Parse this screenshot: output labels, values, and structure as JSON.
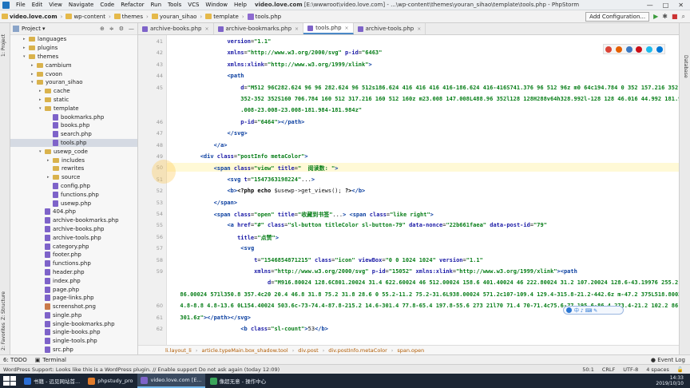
{
  "menubar": {
    "items": [
      "File",
      "Edit",
      "View",
      "Navigate",
      "Code",
      "Refactor",
      "Run",
      "Tools",
      "VCS",
      "Window",
      "Help"
    ],
    "title_project": "video.love.com",
    "title_rest": "[E:\\wwwroot\\video.love.com] - ...\\wp-content\\themes\\youran_sihao\\template\\tools.php - PhpStorm",
    "controls": [
      "—",
      "□",
      "✕"
    ]
  },
  "navbar": {
    "crumbs": [
      "video.love.com",
      "wp-content",
      "themes",
      "youran_sihao",
      "template",
      "tools.php"
    ],
    "config_button": "Add Configuration..."
  },
  "leftstrip": {
    "labels": [
      "1: Project",
      "Z: Structure",
      "2: Favorites"
    ]
  },
  "rightstrip": {
    "label": "Database"
  },
  "project": {
    "title": "Project",
    "tree": [
      {
        "label": "languages",
        "kind": "folder",
        "depth": 2,
        "arrow": "▸"
      },
      {
        "label": "plugins",
        "kind": "folder",
        "depth": 2,
        "arrow": "▸"
      },
      {
        "label": "themes",
        "kind": "folder",
        "depth": 2,
        "arrow": "▾"
      },
      {
        "label": "cambium",
        "kind": "folder",
        "depth": 3,
        "arrow": "▸"
      },
      {
        "label": "cvoon",
        "kind": "folder",
        "depth": 3,
        "arrow": "▸"
      },
      {
        "label": "youran_sihao",
        "kind": "folder",
        "depth": 3,
        "arrow": "▾"
      },
      {
        "label": "cache",
        "kind": "folder",
        "depth": 4,
        "arrow": "▸"
      },
      {
        "label": "static",
        "kind": "folder",
        "depth": 4,
        "arrow": "▸"
      },
      {
        "label": "template",
        "kind": "folder",
        "depth": 4,
        "arrow": "▾"
      },
      {
        "label": "bookmarks.php",
        "kind": "php",
        "depth": 5,
        "arrow": ""
      },
      {
        "label": "books.php",
        "kind": "php",
        "depth": 5,
        "arrow": ""
      },
      {
        "label": "search.php",
        "kind": "php",
        "depth": 5,
        "arrow": ""
      },
      {
        "label": "tools.php",
        "kind": "php",
        "depth": 5,
        "arrow": "",
        "selected": true
      },
      {
        "label": "usewp_code",
        "kind": "folder",
        "depth": 4,
        "arrow": "▾"
      },
      {
        "label": "includes",
        "kind": "folder",
        "depth": 5,
        "arrow": "▸"
      },
      {
        "label": "rewrites",
        "kind": "folder",
        "depth": 5,
        "arrow": ""
      },
      {
        "label": "source",
        "kind": "folder",
        "depth": 5,
        "arrow": "▸"
      },
      {
        "label": "config.php",
        "kind": "php",
        "depth": 5,
        "arrow": ""
      },
      {
        "label": "functions.php",
        "kind": "php",
        "depth": 5,
        "arrow": ""
      },
      {
        "label": "usewp.php",
        "kind": "php",
        "depth": 5,
        "arrow": ""
      },
      {
        "label": "404.php",
        "kind": "php",
        "depth": 4,
        "arrow": ""
      },
      {
        "label": "archive-bookmarks.php",
        "kind": "php",
        "depth": 4,
        "arrow": ""
      },
      {
        "label": "archive-books.php",
        "kind": "php",
        "depth": 4,
        "arrow": ""
      },
      {
        "label": "archive-tools.php",
        "kind": "php",
        "depth": 4,
        "arrow": ""
      },
      {
        "label": "category.php",
        "kind": "php",
        "depth": 4,
        "arrow": ""
      },
      {
        "label": "footer.php",
        "kind": "php",
        "depth": 4,
        "arrow": ""
      },
      {
        "label": "functions.php",
        "kind": "php",
        "depth": 4,
        "arrow": ""
      },
      {
        "label": "header.php",
        "kind": "php",
        "depth": 4,
        "arrow": ""
      },
      {
        "label": "index.php",
        "kind": "php",
        "depth": 4,
        "arrow": ""
      },
      {
        "label": "page.php",
        "kind": "php",
        "depth": 4,
        "arrow": ""
      },
      {
        "label": "page-links.php",
        "kind": "php",
        "depth": 4,
        "arrow": ""
      },
      {
        "label": "screenshot.png",
        "kind": "img",
        "depth": 4,
        "arrow": ""
      },
      {
        "label": "single.php",
        "kind": "php",
        "depth": 4,
        "arrow": ""
      },
      {
        "label": "single-bookmarks.php",
        "kind": "php",
        "depth": 4,
        "arrow": ""
      },
      {
        "label": "single-books.php",
        "kind": "php",
        "depth": 4,
        "arrow": ""
      },
      {
        "label": "single-tools.php",
        "kind": "php",
        "depth": 4,
        "arrow": ""
      },
      {
        "label": "src.php",
        "kind": "php",
        "depth": 4,
        "arrow": ""
      }
    ]
  },
  "tabs": [
    {
      "label": "archive-books.php",
      "active": false
    },
    {
      "label": "archive-bookmarks.php",
      "active": false
    },
    {
      "label": "tools.php",
      "active": true
    },
    {
      "label": "archive-tools.php",
      "active": false
    }
  ],
  "line_numbers": [
    "41",
    "42",
    "43",
    "44",
    "45",
    "",
    "",
    "46",
    "47",
    "48",
    "49",
    "50",
    "51",
    "52",
    "53",
    "54",
    "55",
    "56",
    "57",
    "58",
    "59",
    "",
    "",
    "60",
    "61",
    "62"
  ],
  "code_lines": [
    [
      [
        "",
        "                "
      ],
      [
        "at",
        "version"
      ],
      [
        "",
        "="
      ],
      [
        "sv",
        "\"1.1\""
      ]
    ],
    [
      [
        "",
        "                "
      ],
      [
        "at",
        "xmlns"
      ],
      [
        "",
        "="
      ],
      [
        "sv",
        "\"http://www.w3.org/2000/svg\""
      ],
      [
        "",
        " "
      ],
      [
        "at",
        "p-id"
      ],
      [
        "",
        "="
      ],
      [
        "sv",
        "\"6463\""
      ]
    ],
    [
      [
        "",
        "                "
      ],
      [
        "at",
        "xmlns:xlink"
      ],
      [
        "",
        "="
      ],
      [
        "sv",
        "\"http://www.w3.org/1999/xlink\""
      ],
      [
        "tg",
        ">"
      ]
    ],
    [
      [
        "",
        "                "
      ],
      [
        "tg",
        "<path"
      ]
    ],
    [
      [
        "",
        "                    "
      ],
      [
        "at",
        "d"
      ],
      [
        "",
        "="
      ],
      [
        "sv",
        "\"M512 96C282.624 96 96 282.624 96 512s186.624 416 416 416 416-186.624 416-416S741.376 96 512 96z m0 64c194.784 0 352 157.216 352 352s-157.216"
      ]
    ],
    [
      [
        "sv",
        "                    352-352 352S160 706.784 160 512 317.216 160 512 160z m23.008 147.008L488.96 352l128 128H288v64h328.992l-128 128 46.016 44.992 181.984-181.984 23.008-23"
      ]
    ],
    [
      [
        "sv",
        "                    .008-23.008-23.008-181.984-181.984z\""
      ]
    ],
    [
      [
        "",
        "                    "
      ],
      [
        "at",
        "p-id"
      ],
      [
        "",
        "="
      ],
      [
        "sv",
        "\"6464\""
      ],
      [
        "tg",
        "></path>"
      ]
    ],
    [
      [
        "",
        "                "
      ],
      [
        "tg",
        "</svg>"
      ]
    ],
    [
      [
        "",
        "            "
      ],
      [
        "tg",
        "</a>"
      ]
    ],
    [
      [
        "",
        "        "
      ],
      [
        "tg",
        "<div "
      ],
      [
        "at",
        "class"
      ],
      [
        "",
        "="
      ],
      [
        "sv",
        "\"postInfo metaColor\""
      ],
      [
        "tg",
        ">"
      ]
    ],
    [
      [
        "",
        "            "
      ],
      [
        "tg",
        "<span "
      ],
      [
        "at",
        "class"
      ],
      [
        "",
        "="
      ],
      [
        "sv",
        "\"view\""
      ],
      [
        "",
        " "
      ],
      [
        "at",
        "title"
      ],
      [
        "",
        "="
      ],
      [
        "sv",
        "\"  阅读数: \""
      ],
      [
        "tg",
        ">"
      ]
    ],
    [
      [
        "",
        "                "
      ],
      [
        "tg",
        "<svg "
      ],
      [
        "at",
        "t"
      ],
      [
        "",
        "="
      ],
      [
        "sv",
        "\"1547363198224\""
      ],
      [
        "",
        "..."
      ],
      [
        "tg",
        ">"
      ]
    ],
    [
      [
        "",
        "                "
      ],
      [
        "tg",
        "<b>"
      ],
      [
        "pc",
        "<?php echo "
      ],
      [
        "",
        "$usewp->get_views(); "
      ],
      [
        "pc",
        "?>"
      ],
      [
        "tg",
        "</b>"
      ]
    ],
    [
      [
        "",
        "            "
      ],
      [
        "tg",
        "</span>"
      ]
    ],
    [
      [
        "",
        "            "
      ],
      [
        "tg",
        "<span "
      ],
      [
        "at",
        "class"
      ],
      [
        "",
        "="
      ],
      [
        "sv",
        "\"open\""
      ],
      [
        "",
        " "
      ],
      [
        "at",
        "title"
      ],
      [
        "",
        "="
      ],
      [
        "sv",
        "\"收藏到书签\""
      ],
      [
        "",
        "..."
      ],
      [
        "tg",
        "> <span "
      ],
      [
        "at",
        "class"
      ],
      [
        "",
        "="
      ],
      [
        "sv",
        "\"like right\""
      ],
      [
        "tg",
        ">"
      ]
    ],
    [
      [
        "",
        "                "
      ],
      [
        "tg",
        "<a "
      ],
      [
        "at",
        "href"
      ],
      [
        "",
        "="
      ],
      [
        "sv",
        "\"#\""
      ],
      [
        "",
        " "
      ],
      [
        "at",
        "class"
      ],
      [
        "",
        "="
      ],
      [
        "sv",
        "\"sl-button titleColor sl-button-79\""
      ],
      [
        "",
        " "
      ],
      [
        "at",
        "data-nonce"
      ],
      [
        "",
        "="
      ],
      [
        "sv",
        "\"22b661faea\""
      ],
      [
        "",
        " "
      ],
      [
        "at",
        "data-post-id"
      ],
      [
        "",
        "="
      ],
      [
        "sv",
        "\"79\""
      ]
    ],
    [
      [
        "",
        "                   "
      ],
      [
        "at",
        "title"
      ],
      [
        "",
        "="
      ],
      [
        "sv",
        "\"点赞\""
      ],
      [
        "tg",
        ">"
      ]
    ],
    [
      [
        "",
        "                    "
      ],
      [
        "tg",
        "<svg"
      ]
    ],
    [
      [
        "",
        "                        "
      ],
      [
        "at",
        "t"
      ],
      [
        "",
        "="
      ],
      [
        "sv",
        "\"1546854871215\""
      ],
      [
        "",
        " "
      ],
      [
        "at",
        "class"
      ],
      [
        "",
        "="
      ],
      [
        "sv",
        "\"icon\""
      ],
      [
        "",
        " "
      ],
      [
        "at",
        "viewBox"
      ],
      [
        "",
        "="
      ],
      [
        "sv",
        "\"0 0 1024 1024\""
      ],
      [
        "",
        " "
      ],
      [
        "at",
        "version"
      ],
      [
        "",
        "="
      ],
      [
        "sv",
        "\"1.1\""
      ]
    ],
    [
      [
        "",
        "                        "
      ],
      [
        "at",
        "xmlns"
      ],
      [
        "",
        "="
      ],
      [
        "sv",
        "\"http://www.w3.org/2000/svg\""
      ],
      [
        "",
        " "
      ],
      [
        "at",
        "p-id"
      ],
      [
        "",
        "="
      ],
      [
        "sv",
        "\"15052\""
      ],
      [
        "",
        " "
      ],
      [
        "at",
        "xmlns:xlink"
      ],
      [
        "",
        "="
      ],
      [
        "sv",
        "\"http://www.w3.org/1999/xlink\""
      ],
      [
        "tg",
        "><path"
      ]
    ],
    [
      [
        "",
        "                            "
      ],
      [
        "at",
        "d"
      ],
      [
        "",
        "="
      ],
      [
        "sv",
        "\"M916.80024 128.6C801.20024 31.4 622.60024 46 512.00024 158.6 401.40024 46 222.80024 31.2 107.20024 128.6-43.19976 255.2-21.19976 461.6"
      ]
    ],
    [
      [
        "sv",
        "  86.00024 571l350.8 357.4c20 20.4 46.8 31.8 75.2 31.8 28.6 0 55.2-11.2 75.2-31.6L938.00024 571.2c107-109.4 129.4-315.8-21.2-442.6z m-47.2 375L518.80024 861c-4.8"
      ]
    ],
    [
      [
        "sv",
        "  4.8-8.8 4.8-13.6 0L154.40024 503.6c-73-74.4-87.8-215.2 14.6-301.4 77.8-65.4 197.8-55.6 273 21l70 71.4 70-71.4c75.6-77 195.6-86.4 273.4-21.2 102.2 86.4 87.2 227.8 14.6"
      ]
    ],
    [
      [
        "sv",
        "  301.6z\""
      ],
      [
        "tg",
        "></path></svg>"
      ]
    ],
    [
      [
        "",
        "                    "
      ],
      [
        "tg",
        "<b "
      ],
      [
        "at",
        "class"
      ],
      [
        "",
        "="
      ],
      [
        "sv",
        "\"sl-count\""
      ],
      [
        "tg",
        ">"
      ],
      [
        "",
        "53"
      ],
      [
        "tg",
        "</b>"
      ]
    ]
  ],
  "breadcrumb": [
    "li.layout_li",
    "article.typeMain.box_shadow.tool",
    "div.post",
    "div.postInfo.metaColor",
    "span.open"
  ],
  "toolbar": {
    "todo": "6: TODO",
    "terminal": "Terminal",
    "event_log": "Event Log"
  },
  "status": {
    "message": "WordPress Support: Looks like this is a WordPress plugin. // Enable support   Do not ask again (today 12:09)",
    "position": "50:1",
    "line_sep": "CRLF",
    "encoding": "UTF-8",
    "indent": "4 spaces"
  },
  "taskbar": {
    "items": [
      {
        "label": "书籍 - 远见网站首...",
        "active": false,
        "color": "#2b6fd6"
      },
      {
        "label": "phpstudy_pro",
        "active": false,
        "color": "#e07b2a"
      },
      {
        "label": "video.love.com [E...",
        "active": true,
        "color": "#7e63c9"
      },
      {
        "label": "像超无意 - 操作中心",
        "active": false,
        "color": "#3aa55a"
      }
    ],
    "time": "14:33",
    "date": "2019/10/10"
  },
  "ime_text": "中 ♪ ⌨ ✎"
}
